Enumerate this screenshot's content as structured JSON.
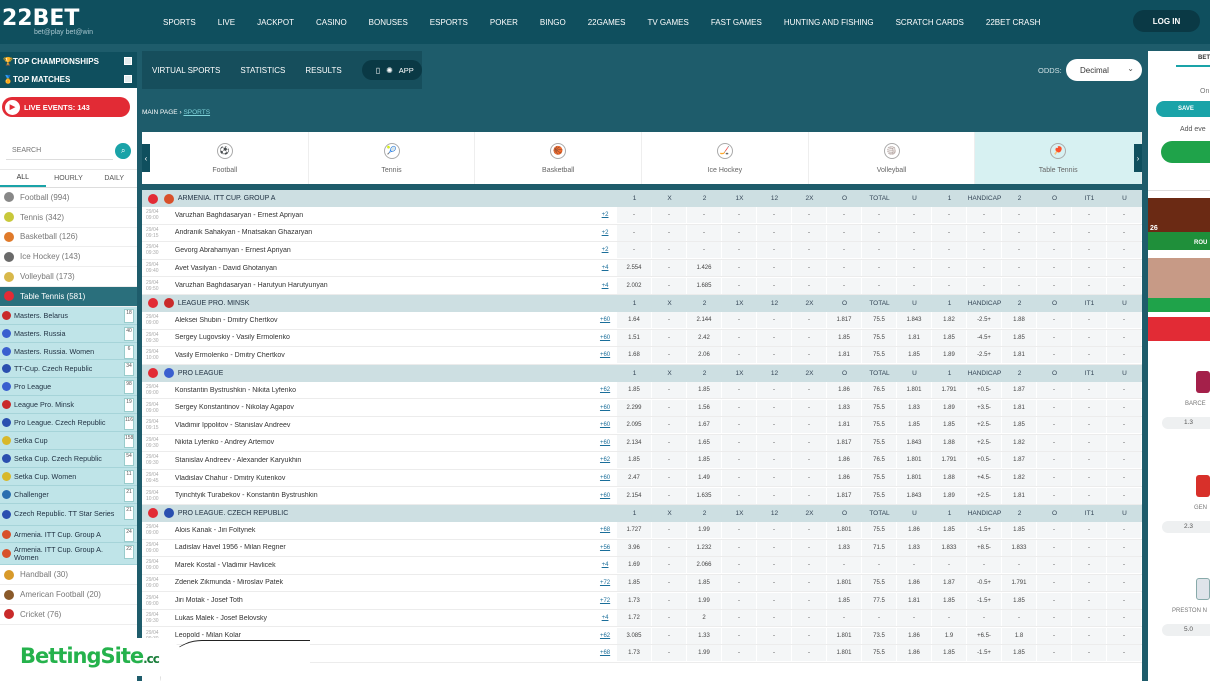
{
  "brand": {
    "logo": "22BET",
    "tagline": "bet@play bet@win"
  },
  "topnav": [
    "SPORTS",
    "LIVE",
    "JACKPOT",
    "CASINO",
    "BONUSES",
    "ESPORTS",
    "POKER",
    "BINGO",
    "22GAMES",
    "TV GAMES",
    "FAST GAMES",
    "HUNTING AND FISHING",
    "SCRATCH CARDS",
    "22BET CRASH"
  ],
  "login": "LOG IN",
  "sidebar": {
    "top_championships": "TOP CHAMPIONSHIPS",
    "top_matches": "TOP MATCHES",
    "live": "LIVE EVENTS: 143",
    "search_placeholder": "SEARCH",
    "tabs": [
      "ALL",
      "HOURLY",
      "DAILY"
    ],
    "sports_before": [
      {
        "label": "Football (994)",
        "color": "#888"
      },
      {
        "label": "Tennis (342)",
        "color": "#c8c83a"
      },
      {
        "label": "Basketball (126)",
        "color": "#e07a2a"
      },
      {
        "label": "Ice Hockey (143)",
        "color": "#6a6a6a"
      },
      {
        "label": "Volleyball (173)",
        "color": "#d8b84a"
      }
    ],
    "active_sport": "Table Tennis (581)",
    "leagues": [
      {
        "label": "Masters. Belarus",
        "count": "18",
        "color": "#c92a2a"
      },
      {
        "label": "Masters. Russia",
        "count": "40",
        "color": "#3a5fcf"
      },
      {
        "label": "Masters. Russia. Women",
        "count": "6",
        "color": "#3a5fcf"
      },
      {
        "label": "TT-Cup. Czech Republic",
        "count": "34",
        "color": "#2a4faf"
      },
      {
        "label": "Pro League",
        "count": "98",
        "color": "#3a5fcf"
      },
      {
        "label": "League Pro. Minsk",
        "count": "19",
        "color": "#c92a2a"
      },
      {
        "label": "Pro League. Czech Republic",
        "count": "116",
        "color": "#2a4faf"
      },
      {
        "label": "Setka Cup",
        "count": "158",
        "color": "#d8b82a"
      },
      {
        "label": "Setka Cup. Czech Republic",
        "count": "54",
        "color": "#2a4faf"
      },
      {
        "label": "Setka Cup. Women",
        "count": "11",
        "color": "#d8b82a"
      },
      {
        "label": "Challenger",
        "count": "21",
        "color": "#2a6faf"
      },
      {
        "label": "Czech Republic. TT Star Series",
        "count": "21",
        "color": "#2a4faf"
      },
      {
        "label": "Armenia. ITT Cup. Group A",
        "count": "24",
        "color": "#d8502a"
      },
      {
        "label": "Armenia. ITT Cup. Group A. Women",
        "count": "22",
        "color": "#d8502a"
      }
    ],
    "sports_after": [
      {
        "label": "Handball (30)",
        "color": "#d89a2a"
      },
      {
        "label": "American Football (20)",
        "color": "#8a5a2a"
      },
      {
        "label": "Cricket (76)",
        "color": "#c92a2a"
      }
    ]
  },
  "subnav": [
    "VIRTUAL SPORTS",
    "STATISTICS",
    "RESULTS"
  ],
  "app_label": "APP",
  "odds": {
    "label": "ODDS:",
    "value": "Decimal"
  },
  "breadcrumb": {
    "home": "MAIN PAGE",
    "sep": "›",
    "current": "SPORTS"
  },
  "carousel": [
    {
      "label": "Football",
      "icon": "⚽"
    },
    {
      "label": "Tennis",
      "icon": "🎾"
    },
    {
      "label": "Basketball",
      "icon": "🏀"
    },
    {
      "label": "Ice Hockey",
      "icon": "🏒"
    },
    {
      "label": "Volleyball",
      "icon": "🏐"
    },
    {
      "label": "Table Tennis",
      "icon": "🏓"
    }
  ],
  "columns": [
    "1",
    "X",
    "2",
    "1X",
    "12",
    "2X",
    "O",
    "TOTAL",
    "U",
    "1",
    "HANDICAP",
    "2",
    "O",
    "IT1",
    "U"
  ],
  "leagues": [
    {
      "name": "ARMENIA. ITT CUP. GROUP A",
      "flag": "#d8502a",
      "events": [
        {
          "time": "29/04\n09:00",
          "teams": "Varuzhan Baghdasaryan - Ernest Apriyan",
          "more": "+2",
          "odds": [
            "-",
            "-",
            "-",
            "-",
            "-",
            "-",
            "-",
            "-",
            "-",
            "-",
            "-",
            "-",
            "-",
            "-",
            "-"
          ]
        },
        {
          "time": "29/04\n09:15",
          "teams": "Andranik Sahakyan - Mnatsakan Ghazaryan",
          "more": "+2",
          "odds": [
            "-",
            "-",
            "-",
            "-",
            "-",
            "-",
            "-",
            "-",
            "-",
            "-",
            "-",
            "-",
            "-",
            "-",
            "-"
          ]
        },
        {
          "time": "29/04\n09:30",
          "teams": "Gevorg Abrahamyan - Ernest Apriyan",
          "more": "+2",
          "odds": [
            "-",
            "-",
            "-",
            "-",
            "-",
            "-",
            "-",
            "-",
            "-",
            "-",
            "-",
            "-",
            "-",
            "-",
            "-"
          ]
        },
        {
          "time": "29/04\n09:40",
          "teams": "Avet Vasilyan - David Ghotanyan",
          "more": "+4",
          "odds": [
            "2.554",
            "-",
            "1.426",
            "-",
            "-",
            "-",
            "-",
            "-",
            "-",
            "-",
            "-",
            "-",
            "-",
            "-",
            "-"
          ]
        },
        {
          "time": "29/04\n09:50",
          "teams": "Varuzhan Baghdasaryan - Harutyun Harutyunyan",
          "more": "+4",
          "odds": [
            "2.002",
            "-",
            "1.685",
            "-",
            "-",
            "-",
            "-",
            "-",
            "-",
            "-",
            "-",
            "-",
            "-",
            "-",
            "-"
          ]
        }
      ]
    },
    {
      "name": "LEAGUE PRO. MINSK",
      "flag": "#c92a2a",
      "events": [
        {
          "time": "29/04\n09:00",
          "teams": "Aleksei Shubin - Dmitry Chertkov",
          "more": "+60",
          "odds": [
            "1.64",
            "-",
            "2.144",
            "-",
            "-",
            "-",
            "1.817",
            "75.5",
            "1.843",
            "1.82",
            "-2.5+",
            "1.88",
            "-",
            "-",
            "-"
          ]
        },
        {
          "time": "29/04\n09:30",
          "teams": "Sergey Lugovskiy - Vasily Ermolenko",
          "more": "+60",
          "odds": [
            "1.51",
            "-",
            "2.42",
            "-",
            "-",
            "-",
            "1.85",
            "75.5",
            "1.81",
            "1.85",
            "-4.5+",
            "1.85",
            "-",
            "-",
            "-"
          ]
        },
        {
          "time": "29/04\n10:00",
          "teams": "Vasily Ermolenko - Dmitry Chertkov",
          "more": "+60",
          "odds": [
            "1.68",
            "-",
            "2.06",
            "-",
            "-",
            "-",
            "1.81",
            "75.5",
            "1.85",
            "1.89",
            "-2.5+",
            "1.81",
            "-",
            "-",
            "-"
          ]
        }
      ]
    },
    {
      "name": "PRO LEAGUE",
      "flag": "#3a5fcf",
      "events": [
        {
          "time": "29/04\n09:00",
          "teams": "Konstantin Bystrushkin - Nikita Lyfenko",
          "more": "+62",
          "odds": [
            "1.85",
            "-",
            "1.85",
            "-",
            "-",
            "-",
            "1.86",
            "76.5",
            "1.801",
            "1.791",
            "+0.5-",
            "1.87",
            "-",
            "-",
            "-"
          ]
        },
        {
          "time": "29/04\n09:00",
          "teams": "Sergey Konstantinov - Nikolay Agapov",
          "more": "+60",
          "odds": [
            "2.299",
            "-",
            "1.56",
            "-",
            "-",
            "-",
            "1.83",
            "75.5",
            "1.83",
            "1.89",
            "+3.5-",
            "1.81",
            "-",
            "-",
            "-"
          ]
        },
        {
          "time": "29/04\n09:15",
          "teams": "Vladimir Ippolitov - Stanislav Andreev",
          "more": "+60",
          "odds": [
            "2.095",
            "-",
            "1.67",
            "-",
            "-",
            "-",
            "1.81",
            "75.5",
            "1.85",
            "1.85",
            "+2.5-",
            "1.85",
            "-",
            "-",
            "-"
          ]
        },
        {
          "time": "29/04\n09:30",
          "teams": "Nikita Lyfenko - Andrey Artemov",
          "more": "+60",
          "odds": [
            "2.134",
            "-",
            "1.65",
            "-",
            "-",
            "-",
            "1.817",
            "75.5",
            "1.843",
            "1.88",
            "+2.5-",
            "1.82",
            "-",
            "-",
            "-"
          ]
        },
        {
          "time": "29/04\n09:30",
          "teams": "Stanislav Andreev - Alexander Karyukhin",
          "more": "+62",
          "odds": [
            "1.85",
            "-",
            "1.85",
            "-",
            "-",
            "-",
            "1.86",
            "76.5",
            "1.801",
            "1.791",
            "+0.5-",
            "1.87",
            "-",
            "-",
            "-"
          ]
        },
        {
          "time": "29/04\n09:45",
          "teams": "Vladislav Chahur - Dmitry Kutenkov",
          "more": "+60",
          "odds": [
            "2.47",
            "-",
            "1.49",
            "-",
            "-",
            "-",
            "1.86",
            "75.5",
            "1.801",
            "1.88",
            "+4.5-",
            "1.82",
            "-",
            "-",
            "-"
          ]
        },
        {
          "time": "29/04\n10:00",
          "teams": "Tyinchtyik Turabekov - Konstantin Bystrushkin",
          "more": "+60",
          "odds": [
            "2.154",
            "-",
            "1.635",
            "-",
            "-",
            "-",
            "1.817",
            "75.5",
            "1.843",
            "1.89",
            "+2.5-",
            "1.81",
            "-",
            "-",
            "-"
          ]
        }
      ]
    },
    {
      "name": "PRO LEAGUE. CZECH REPUBLIC",
      "flag": "#2a4faf",
      "events": [
        {
          "time": "29/04\n09:00",
          "teams": "Alois Kanak - Jiri Foltynek",
          "more": "+68",
          "odds": [
            "1.727",
            "-",
            "1.99",
            "-",
            "-",
            "-",
            "1.801",
            "75.5",
            "1.86",
            "1.85",
            "-1.5+",
            "1.85",
            "-",
            "-",
            "-"
          ]
        },
        {
          "time": "29/04\n09:00",
          "teams": "Ladislav Havel 1956 - Milan Regner",
          "more": "+56",
          "odds": [
            "3.96",
            "-",
            "1.232",
            "-",
            "-",
            "-",
            "1.83",
            "71.5",
            "1.83",
            "1.833",
            "+8.5-",
            "1.833",
            "-",
            "-",
            "-"
          ]
        },
        {
          "time": "29/04\n09:00",
          "teams": "Marek Kostal - Vladimir Havlicek",
          "more": "+4",
          "odds": [
            "1.69",
            "-",
            "2.066",
            "-",
            "-",
            "-",
            "-",
            "-",
            "-",
            "-",
            "-",
            "-",
            "-",
            "-",
            "-"
          ]
        },
        {
          "time": "29/04\n09:00",
          "teams": "Zdenek Zikmunda - Miroslav Patek",
          "more": "+72",
          "odds": [
            "1.85",
            "-",
            "1.85",
            "-",
            "-",
            "-",
            "1.801",
            "75.5",
            "1.86",
            "1.87",
            "-0.5+",
            "1.791",
            "-",
            "-",
            "-"
          ]
        },
        {
          "time": "29/04\n09:00",
          "teams": "Jiri Motak - Josef Toth",
          "more": "+72",
          "odds": [
            "1.73",
            "-",
            "1.99",
            "-",
            "-",
            "-",
            "1.85",
            "77.5",
            "1.81",
            "1.85",
            "-1.5+",
            "1.85",
            "-",
            "-",
            "-"
          ]
        },
        {
          "time": "29/04\n09:30",
          "teams": "Lukas Malek - Josef Belovsky",
          "more": "+4",
          "odds": [
            "1.72",
            "-",
            "2",
            "-",
            "-",
            "-",
            "-",
            "-",
            "-",
            "-",
            "-",
            "-",
            "-",
            "-",
            "-"
          ]
        },
        {
          "time": "29/04\n09:30",
          "teams": "Leopold - Milan Kolar",
          "more": "+62",
          "odds": [
            "3.085",
            "-",
            "1.33",
            "-",
            "-",
            "-",
            "1.801",
            "73.5",
            "1.86",
            "1.9",
            "+6.5-",
            "1.8",
            "-",
            "-",
            "-"
          ]
        },
        {
          "time": "29/04\n09:30",
          "teams": "- Jiri Hiblbauer",
          "more": "+68",
          "odds": [
            "1.73",
            "-",
            "1.99",
            "-",
            "-",
            "-",
            "1.801",
            "75.5",
            "1.86",
            "1.85",
            "-1.5+",
            "1.85",
            "-",
            "-",
            "-"
          ]
        }
      ]
    }
  ],
  "right_panel": {
    "tab": "BET",
    "text1": "On",
    "save": "SAVE",
    "text2": "Add eve",
    "promo1_label": "ROU",
    "promo1_num": "26",
    "matches": [
      {
        "team": "BARCE",
        "odd": "1.3"
      },
      {
        "team": "GEN",
        "odd": "2.3"
      },
      {
        "team": "PRESTON N",
        "odd": "5.0"
      }
    ]
  },
  "watermark": {
    "text": "BettingSite",
    "suffix": ".cc"
  }
}
